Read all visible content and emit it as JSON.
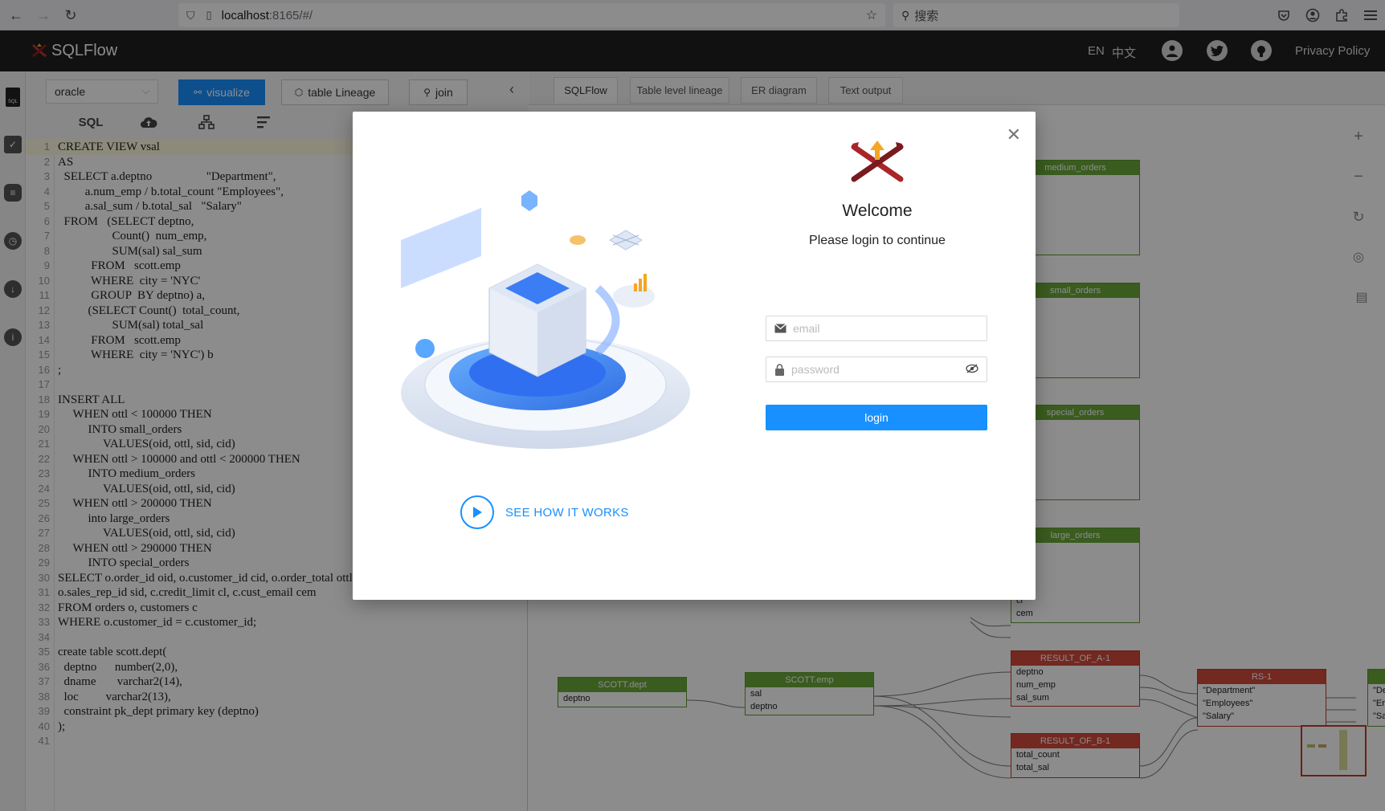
{
  "browser": {
    "url_host": "localhost",
    "url_rest": ":8165/#/",
    "search_placeholder": "搜索"
  },
  "header": {
    "app_title": "SQLFlow",
    "lang_en": "EN",
    "lang_zh": "中文",
    "privacy": "Privacy Policy"
  },
  "toolbar": {
    "db_value": "oracle",
    "visualize_label": "visualize",
    "table_lineage_label": "table Lineage",
    "join_label": "join",
    "sql_label": "SQL"
  },
  "editor": {
    "lines": [
      "CREATE VIEW vsal",
      "AS",
      "  SELECT a.deptno                  \"Department\",",
      "         a.num_emp / b.total_count \"Employees\",",
      "         a.sal_sum / b.total_sal   \"Salary\"",
      "  FROM   (SELECT deptno,",
      "                  Count()  num_emp,",
      "                  SUM(sal) sal_sum",
      "           FROM   scott.emp",
      "           WHERE  city = 'NYC'",
      "           GROUP  BY deptno) a,",
      "          (SELECT Count()  total_count,",
      "                  SUM(sal) total_sal",
      "           FROM   scott.emp",
      "           WHERE  city = 'NYC') b",
      ";",
      "",
      "INSERT ALL",
      "     WHEN ottl < 100000 THEN",
      "          INTO small_orders",
      "               VALUES(oid, ottl, sid, cid)",
      "     WHEN ottl > 100000 and ottl < 200000 THEN",
      "          INTO medium_orders",
      "               VALUES(oid, ottl, sid, cid)",
      "     WHEN ottl > 200000 THEN",
      "          into large_orders",
      "               VALUES(oid, ottl, sid, cid)",
      "     WHEN ottl > 290000 THEN",
      "          INTO special_orders",
      "SELECT o.order_id oid, o.customer_id cid, o.order_total ottl,",
      "o.sales_rep_id sid, c.credit_limit cl, c.cust_email cem",
      "FROM orders o, customers c",
      "WHERE o.customer_id = c.customer_id;",
      "",
      "create table scott.dept(",
      "  deptno      number(2,0),",
      "  dname       varchar2(14),",
      "  loc         varchar2(13),",
      "  constraint pk_dept primary key (deptno)",
      ");",
      ""
    ]
  },
  "right_tabs": [
    "SQLFlow",
    "Table level lineage",
    "ER diagram",
    "Text output"
  ],
  "diagram": {
    "nodes": [
      {
        "title": "medium_orders",
        "fields": []
      },
      {
        "title": "small_orders",
        "fields": []
      },
      {
        "title": "special_orders",
        "fields": []
      },
      {
        "title": "large_orders",
        "fields": [
          "cl",
          "cem"
        ]
      },
      {
        "title": "SCOTT.dept",
        "fields": [
          "deptno"
        ]
      },
      {
        "title": "SCOTT.emp",
        "fields": [
          "sal",
          "deptno"
        ]
      },
      {
        "title": "RESULT_OF_A-1",
        "fields": [
          "deptno",
          "num_emp",
          "sal_sum"
        ]
      },
      {
        "title": "RESULT_OF_B-1",
        "fields": [
          "total_count",
          "total_sal"
        ]
      },
      {
        "title": "RS-1",
        "fields": [
          "\"Department\"",
          "\"Employees\"",
          "\"Salary\""
        ]
      },
      {
        "title": "",
        "fields": [
          "\"De",
          "\"Er",
          "\"Sa"
        ]
      }
    ]
  },
  "modal": {
    "welcome": "Welcome",
    "subtitle": "Please login to continue",
    "email_placeholder": "email",
    "password_placeholder": "password",
    "login_label": "login",
    "see_how": "SEE HOW IT WORKS"
  },
  "colors": {
    "primary": "#1890ff",
    "header_bg": "#1f1f1f",
    "node_green": "#6aa83a",
    "node_red": "#d24a3b",
    "keyword": "#770088"
  }
}
